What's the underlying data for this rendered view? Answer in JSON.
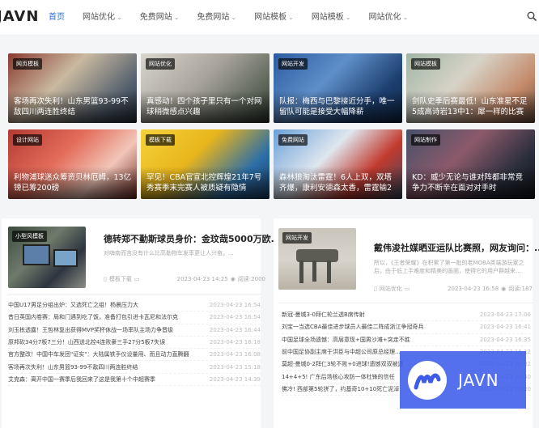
{
  "header": {
    "logo": "JAVN",
    "nav": [
      {
        "label": "首页",
        "active": true,
        "dropdown": false
      },
      {
        "label": "网站优化",
        "active": false,
        "dropdown": true
      },
      {
        "label": "免费网站",
        "active": false,
        "dropdown": true
      },
      {
        "label": "免费网站",
        "active": false,
        "dropdown": true
      },
      {
        "label": "网站模板",
        "active": false,
        "dropdown": true
      },
      {
        "label": "网站模板",
        "active": false,
        "dropdown": true
      },
      {
        "label": "网站优化",
        "active": false,
        "dropdown": true
      }
    ],
    "search_icon": "search-icon"
  },
  "grid": [
    {
      "tag": "网页模板",
      "title": "客场再次失利！山东男篮93-99不敌四川两连胜终结"
    },
    {
      "tag": "网站优化",
      "title": "真感动！四个孩子里只有一个对网球稍微感点兴趣"
    },
    {
      "tag": "网站开发",
      "title": "队报：梅西与巴黎接近分手，唯一留队可能是接受大幅降薪"
    },
    {
      "tag": "网站模板",
      "title": "剑队史季后赛最低！山东准星不足5成高诗岩13中1：犀一样的比赛"
    },
    {
      "tag": "设计网站",
      "title": "利物浦球迷众筹资贝林厄姆，13亿镑已筹200磅"
    },
    {
      "tag": "模板下载",
      "title": "罕见！CBA官宣北控辉煌21年7号秀赛季末完赛人被质疑有隐情"
    },
    {
      "tag": "免费网站",
      "title": "森林狼淘汰雷霆！6人上双，双塔齐爆，康利安德森太香，雷霆输2点"
    },
    {
      "tag": "网站制作",
      "title": "KD：威少无论与谁对阵都非常竞争力不断辛在面对对手时"
    }
  ],
  "left": {
    "feature": {
      "tag": "小型风模板",
      "title": "德转郑不勤斯球员身价：金玟哉5000万欧...",
      "summary": "对嗨南而言没有什么比高勒物车发率更让人兴奋。...",
      "category": "模板下载",
      "date": "2023-04-23 14:25",
      "views": "阅读:2000"
    },
    "items": [
      {
        "title": "中国U17男足分组出炉：又选死亡之组！杨晨压力大",
        "date": "2023-04-23 16:54"
      },
      {
        "title": "昔日英国内卷赛：局和门遇到吃了饭，准备打包引进卡瓦尼和法尔克",
        "date": "2023-04-23 16:54"
      },
      {
        "title": "刘玉栋透露！王哲林复出获得MVP奖杯休战一场率队主场力争晋级",
        "date": "2023-04-23 16:44"
      },
      {
        "title": "原邦砍34分7板7三分！山西送北控4连败豪三手27分5板7失误",
        "date": "2023-04-23 16:18"
      },
      {
        "title": "官方整改！中国中车发团\"证实\"：大陆属铁手仪设量用、而且动力直腾翻",
        "date": "2023-04-23 16:08"
      },
      {
        "title": "客场再次失利！山东男篮93-99不敌四川两连胜终结",
        "date": "2023-04-23 15:18"
      },
      {
        "title": "艾克森：离开中国一赛季后我回来了这是我第十个中超赛季",
        "date": "2023-04-23 14:39"
      }
    ]
  },
  "right": {
    "feature": {
      "tag": "网站开发",
      "title": "戴伟浚社媒晒亚运队比赛照，网友询问：...",
      "summary": "所以，《王者荣耀》在积累了第一批的老MOBA类端游玩家之后，由于低上手难度和精美的画面，使得它的用户群越来...",
      "category": "网站优化",
      "date": "2023-04-23 16:58",
      "views": "阅读:187"
    },
    "items": [
      {
        "title": "新冠-曼城3-0拜仁轮兰透B席传射",
        "date": "2023-04-23 17:00"
      },
      {
        "title": "刘宝一当选CBA最佳进步球员人最佳二阵成浙江争冠奇兵",
        "date": "2023-04-23 16:41"
      },
      {
        "title": "中国足球全场遗憾：高层意现+国男沙滩+突走不胜",
        "date": "2023-04-23 16:35"
      },
      {
        "title": "前中国足协副主席于洪臣与中超公司原总经理...",
        "date": "2023-04-23 16:12"
      },
      {
        "title": "莫超-曼城0-2拜仁3轮不败+0进球!遗憾双双被逐",
        "date": "2023-04-23 16:02"
      },
      {
        "title": "14+4+5! 广东后场核心攻防一体杜锋的信任",
        "date": "2023-04-23 15:40"
      },
      {
        "title": "佛冷! 西部第5轮拼了，约基奇10+10死亡泥淖",
        "date": "2023-04-23 15:20"
      }
    ]
  },
  "watermark": {
    "text": "JAVN"
  }
}
